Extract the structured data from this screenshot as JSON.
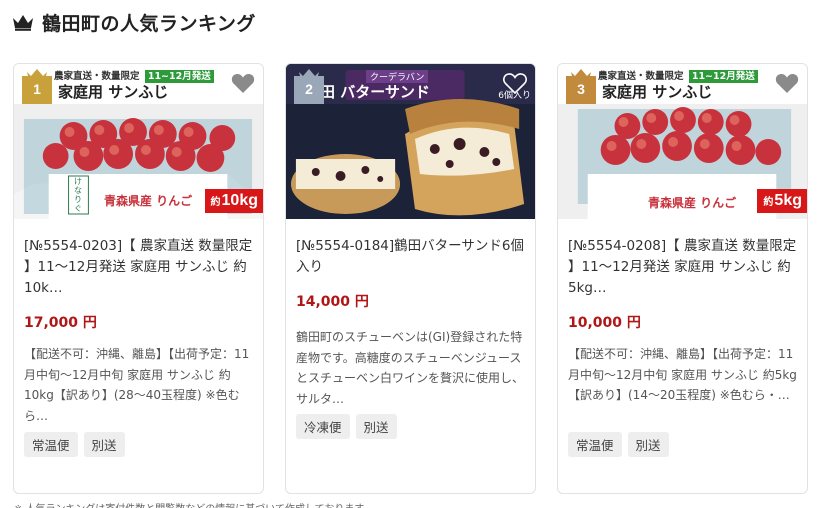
{
  "section": {
    "title": "鶴田町の人気ランキング",
    "icon": "crown-icon"
  },
  "colors": {
    "price": "#b01616",
    "rank_gold": "#c9a13a",
    "rank_silver": "#9aa7b8",
    "weight_badge": "#d81818"
  },
  "items": [
    {
      "rank": "1",
      "title": "[№5554-0203]【 農家直送 数量限定 】11～12月発送 家庭用 サンふじ 約 10k…",
      "price": "17,000 円",
      "description": "【配送不可：沖縄、離島】【出荷予定：11月中旬～12月中旬 家庭用 サンふじ 約10kg【訳あり】(28～40玉程度) ※色むら…",
      "tags": [
        "常温便",
        "別送"
      ],
      "image": {
        "banner_top": "農家直送・数量限定",
        "banner_period": "11~12月発送",
        "banner_main": "家庭用 サンふじ",
        "box_text": "青森県産 りんご",
        "box_side": "けなりぐ",
        "weight_prefix": "約",
        "weight_value": "10kg"
      }
    },
    {
      "rank": "2",
      "title": "[№5554-0184]鶴田バターサンド6個入り",
      "price": "14,000 円",
      "description": "鶴田町のスチューベンは(GI)登録された特産物です。高糖度のスチューベンジュースとスチューベン白ワインを贅沢に使用し、サルタ…",
      "tags": [
        "冷凍便",
        "別送"
      ],
      "image": {
        "label_top": "クーデラバン",
        "label_main": "田 バターサンド",
        "count": "6個入り"
      }
    },
    {
      "rank": "3",
      "title": "[№5554-0208]【 農家直送 数量限定 】11～12月発送 家庭用 サンふじ 約 5kg…",
      "price": "10,000 円",
      "description": "【配送不可：沖縄、離島】【出荷予定：11月中旬～12月中旬 家庭用 サンふじ 約5kg【訳あり】(14～20玉程度) ※色むら・…",
      "tags": [
        "常温便",
        "別送"
      ],
      "image": {
        "banner_top": "農家直送・数量限定",
        "banner_period": "11~12月発送",
        "banner_main": "家庭用 サンふじ",
        "box_text": "青森県産 りんご",
        "weight_prefix": "約",
        "weight_value": "5kg"
      }
    }
  ],
  "footnote": "※ 人気ランキングは寄付件数と閲覧数などの情報に基づいて作成しております。"
}
